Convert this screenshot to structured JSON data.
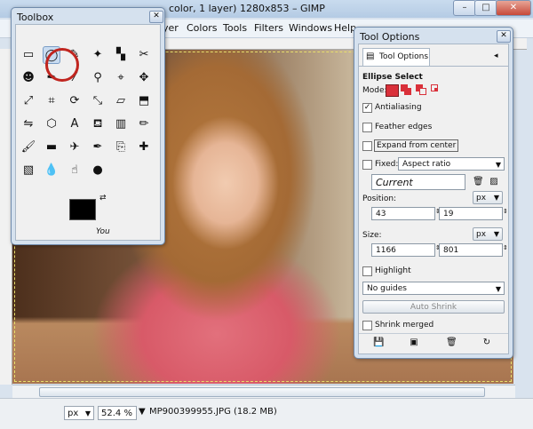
{
  "window": {
    "title": "color, 1 layer) 1280x853 – GIMP",
    "min_glyph": "–",
    "max_glyph": "□",
    "close_glyph": "✕"
  },
  "menubar": {
    "items": [
      "yer",
      "Colors",
      "Tools",
      "Filters",
      "Windows",
      "Help"
    ]
  },
  "status": {
    "unit": "px",
    "zoom": "52.4 %",
    "file": "MP900399955.JPG (18.2 MB)"
  },
  "toolbox": {
    "title": "Toolbox",
    "close_glyph": "✕",
    "tools": [
      {
        "name": "rect-select-icon",
        "glyph": "▭"
      },
      {
        "name": "ellipse-select-icon",
        "glyph": "◯"
      },
      {
        "name": "free-select-icon",
        "glyph": "✎"
      },
      {
        "name": "fuzzy-select-icon",
        "glyph": "✦"
      },
      {
        "name": "select-by-color-icon",
        "glyph": "▚"
      },
      {
        "name": "scissors-icon",
        "glyph": "✂"
      },
      {
        "name": "foreground-select-icon",
        "glyph": "☻"
      },
      {
        "name": "paths-icon",
        "glyph": "✒"
      },
      {
        "name": "color-picker-icon",
        "glyph": "⁄"
      },
      {
        "name": "zoom-icon",
        "glyph": "⚲"
      },
      {
        "name": "measure-icon",
        "glyph": "⌖"
      },
      {
        "name": "move-icon",
        "glyph": "✥"
      },
      {
        "name": "align-icon",
        "glyph": "⤢"
      },
      {
        "name": "crop-icon",
        "glyph": "⌗"
      },
      {
        "name": "rotate-icon",
        "glyph": "⟳"
      },
      {
        "name": "scale-icon",
        "glyph": "⤡"
      },
      {
        "name": "shear-icon",
        "glyph": "▱"
      },
      {
        "name": "perspective-icon",
        "glyph": "⬒"
      },
      {
        "name": "flip-icon",
        "glyph": "⇋"
      },
      {
        "name": "cage-icon",
        "glyph": "⬡"
      },
      {
        "name": "text-icon",
        "glyph": "A"
      },
      {
        "name": "bucket-fill-icon",
        "glyph": "⛾"
      },
      {
        "name": "blend-icon",
        "glyph": "▥"
      },
      {
        "name": "pencil-icon",
        "glyph": "✏"
      },
      {
        "name": "paintbrush-icon",
        "glyph": "🖌"
      },
      {
        "name": "eraser-icon",
        "glyph": "▬"
      },
      {
        "name": "airbrush-icon",
        "glyph": "✈"
      },
      {
        "name": "ink-icon",
        "glyph": "✒"
      },
      {
        "name": "clone-icon",
        "glyph": "⎘"
      },
      {
        "name": "heal-icon",
        "glyph": "✚"
      },
      {
        "name": "perspective-clone-icon",
        "glyph": "▧"
      },
      {
        "name": "blur-icon",
        "glyph": "💧"
      },
      {
        "name": "smudge-icon",
        "glyph": "☝"
      },
      {
        "name": "dodge-burn-icon",
        "glyph": "●"
      }
    ],
    "fg_color": "#000000",
    "bg_color": "#ffffff",
    "caption": "You"
  },
  "tool_options": {
    "title": "Tool Options",
    "close_glyph": "✕",
    "tab_label": "Tool Options",
    "heading": "Ellipse Select",
    "mode_label": "Mode:",
    "antialiasing": {
      "label": "Antialiasing",
      "checked": "✓"
    },
    "feather_edges": "Feather edges",
    "expand_from_center": "Expand from center",
    "fixed_label": "Fixed:",
    "fixed_value": "Aspect ratio",
    "current_value": "Current",
    "position_label": "Position:",
    "position_unit": "px",
    "pos_x": "43",
    "pos_y": "19",
    "size_label": "Size:",
    "size_unit": "px",
    "size_w": "1166",
    "size_h": "801",
    "highlight": "Highlight",
    "guides_value": "No guides",
    "auto_shrink": "Auto Shrink",
    "shrink_merged": "Shrink merged",
    "accent": "#d9303a"
  }
}
